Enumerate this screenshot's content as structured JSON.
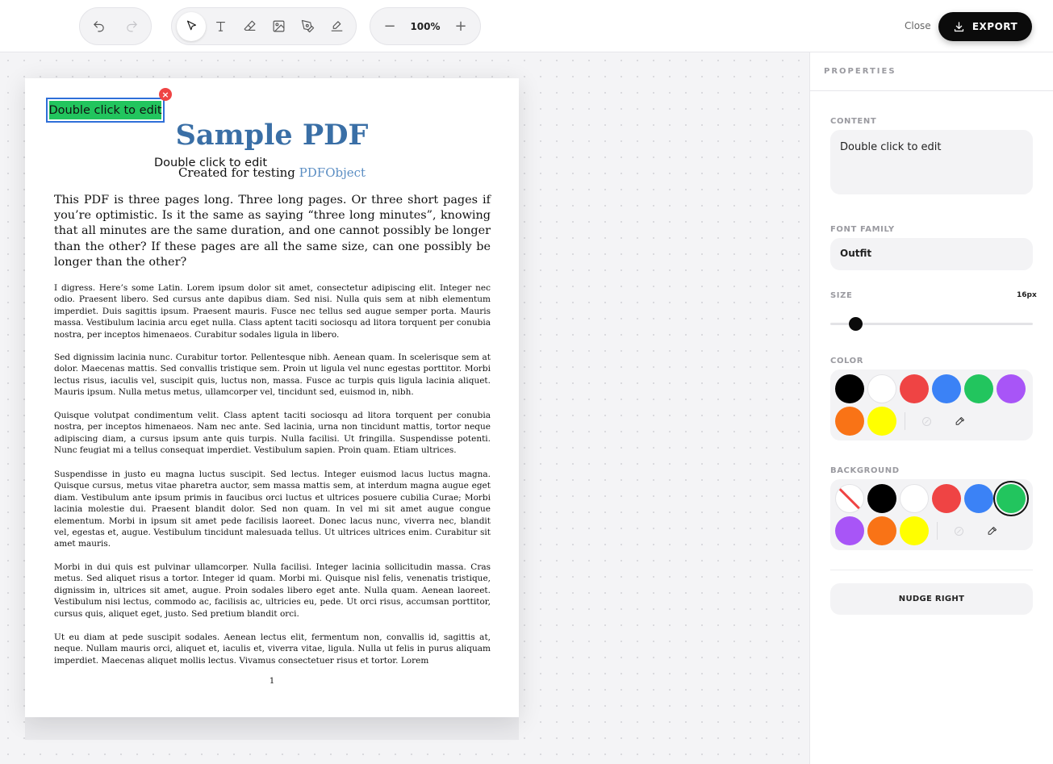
{
  "toolbar": {
    "history": [
      {
        "name": "undo",
        "icon": "undo-icon",
        "enabled": true
      },
      {
        "name": "redo",
        "icon": "redo-icon",
        "enabled": false
      }
    ],
    "tools": [
      {
        "name": "select",
        "icon": "cursor-icon",
        "active": true
      },
      {
        "name": "text",
        "icon": "text-icon",
        "active": false
      },
      {
        "name": "eraser",
        "icon": "eraser-icon",
        "active": false
      },
      {
        "name": "image",
        "icon": "image-icon",
        "active": false
      },
      {
        "name": "pen",
        "icon": "pen-nib-icon",
        "active": false
      },
      {
        "name": "signature",
        "icon": "signature-icon",
        "active": false
      }
    ],
    "zoom": {
      "minus": "−",
      "level": "100%",
      "plus": "+"
    },
    "close_label": "Close",
    "export_label": "EXPORT"
  },
  "document": {
    "title": "Sample PDF",
    "subtitle_prefix": "Created for testing ",
    "subtitle_link": "PDFObject",
    "lead": "This PDF is three pages long. Three long pages. Or three short pages if you’re optimistic. Is it the same as saying “three long minutes”, knowing that all minutes are the same duration, and one cannot possibly be longer than the other? If these pages are all the same size, can one possibly be longer than the other?",
    "paragraphs": [
      "I digress. Here’s some Latin. Lorem ipsum dolor sit amet, consectetur adipiscing elit. Integer nec odio. Praesent libero. Sed cursus ante dapibus diam. Sed nisi. Nulla quis sem at nibh elementum imperdiet. Duis sagittis ipsum. Praesent mauris. Fusce nec tellus sed augue semper porta. Mauris massa. Vestibulum lacinia arcu eget nulla. Class aptent taciti sociosqu ad litora torquent per conubia nostra, per inceptos himenaeos. Curabitur sodales ligula in libero.",
      "Sed dignissim lacinia nunc. Curabitur tortor. Pellentesque nibh. Aenean quam. In scelerisque sem at dolor. Maecenas mattis. Sed convallis tristique sem. Proin ut ligula vel nunc egestas porttitor. Morbi lectus risus, iaculis vel, suscipit quis, luctus non, massa. Fusce ac turpis quis ligula lacinia aliquet. Mauris ipsum. Nulla metus metus, ullamcorper vel, tincidunt sed, euismod in, nibh.",
      "Quisque volutpat condimentum velit. Class aptent taciti sociosqu ad litora torquent per conubia nostra, per inceptos himenaeos. Nam nec ante. Sed lacinia, urna non tincidunt mattis, tortor neque adipiscing diam, a cursus ipsum ante quis turpis. Nulla facilisi. Ut fringilla. Suspendisse potenti. Nunc feugiat mi a tellus consequat imperdiet. Vestibulum sapien. Proin quam. Etiam ultrices.",
      "Suspendisse in justo eu magna luctus suscipit. Sed lectus. Integer euismod lacus luctus magna. Quisque cursus, metus vitae pharetra auctor, sem massa mattis sem, at interdum magna augue eget diam. Vestibulum ante ipsum primis in faucibus orci luctus et ultrices posuere cubilia Curae; Morbi lacinia molestie dui. Praesent blandit dolor. Sed non quam. In vel mi sit amet augue congue elementum. Morbi in ipsum sit amet pede facilisis laoreet. Donec lacus nunc, viverra nec, blandit vel, egestas et, augue. Vestibulum tincidunt malesuada tellus. Ut ultrices ultrices enim. Curabitur sit amet mauris.",
      "Morbi in dui quis est pulvinar ullamcorper. Nulla facilisi. Integer lacinia sollicitudin massa. Cras metus. Sed aliquet risus a tortor. Integer id quam. Morbi mi. Quisque nisl felis, venenatis tristique, dignissim in, ultrices sit amet, augue. Proin sodales libero eget ante. Nulla quam. Aenean laoreet. Vestibulum nisi lectus, commodo ac, facilisis ac, ultricies eu, pede. Ut orci risus, accumsan porttitor, cursus quis, aliquet eget, justo. Sed pretium blandit orci.",
      "Ut eu diam at pede suscipit sodales. Aenean lectus elit, fermentum non, convallis id, sagittis at, neque. Nullam mauris orci, aliquet et, iaculis et, viverra vitae, ligula. Nulla ut felis in purus aliquam imperdiet. Maecenas aliquet mollis lectus. Vivamus consectetuer risus et tortor. Lorem"
    ],
    "page_number": "1"
  },
  "annotations": {
    "selected_text": "Double click to edit",
    "selected_background": "#22c55e",
    "remove_glyph": "×",
    "plain_text": "Double click to edit"
  },
  "panel": {
    "header": "PROPERTIES",
    "content_label": "CONTENT",
    "content_value": "Double click to edit",
    "font_family_label": "FONT FAMILY",
    "font_family_value": "Outfit",
    "size_label": "SIZE",
    "size_value": "16px",
    "size_fraction": 0.1,
    "color_label": "COLOR",
    "colors": [
      "#000000",
      "#ffffff",
      "#ef4444",
      "#3b82f6",
      "#22c55e",
      "#a855f7",
      "#f97316",
      "#ffff00"
    ],
    "background_label": "BACKGROUND",
    "background_colors": [
      "none",
      "#000000",
      "#ffffff",
      "#ef4444",
      "#3b82f6",
      "#22c55e",
      "#a855f7",
      "#f97316",
      "#ffff00"
    ],
    "background_selected": "#22c55e",
    "nudge_label": "NUDGE RIGHT"
  }
}
